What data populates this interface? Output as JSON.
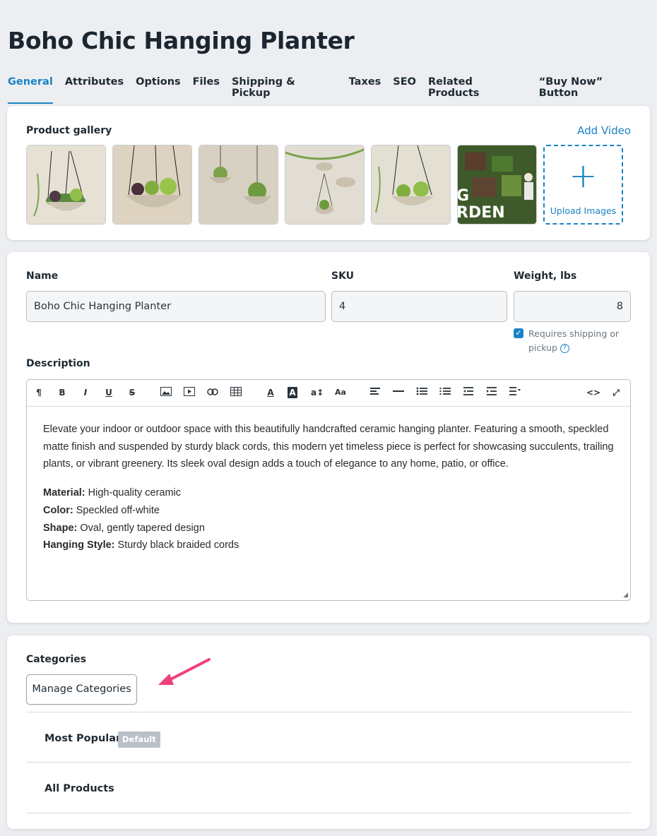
{
  "page": {
    "title": "Boho Chic Hanging Planter"
  },
  "tabs": [
    "General",
    "Attributes",
    "Options",
    "Files",
    "Shipping & Pickup",
    "Taxes",
    "SEO",
    "Related Products",
    "“Buy Now” Button"
  ],
  "gallery": {
    "label": "Product gallery",
    "add_video": "Add Video",
    "upload_label": "Upload Images",
    "thumbnails": [
      {
        "name": "planter-photo-1",
        "text": ""
      },
      {
        "name": "planter-photo-2",
        "text": ""
      },
      {
        "name": "planter-photo-3",
        "text": ""
      },
      {
        "name": "planter-photo-4",
        "text": ""
      },
      {
        "name": "planter-photo-5",
        "text": ""
      },
      {
        "name": "garden-video-thumbnail",
        "text": "G\nRDEN"
      }
    ]
  },
  "details": {
    "name_label": "Name",
    "name_value": "Boho Chic Hanging Planter",
    "sku_label": "SKU",
    "sku_value": "4",
    "weight_label": "Weight, lbs",
    "weight_value": "8",
    "requires_shipping": "Requires shipping or pickup",
    "requires_shipping_checked": true,
    "description_label": "Description",
    "description_paragraph": "Elevate your indoor or outdoor space with this beautifully handcrafted ceramic hanging planter. Featuring a smooth, speckled matte finish and suspended by sturdy black cords, this modern yet timeless piece is perfect for showcasing succulents, trailing plants, or vibrant greenery. Its sleek oval design adds a touch of elegance to any home, patio, or office.",
    "specs": [
      {
        "key": "Material:",
        "value": "High-quality ceramic"
      },
      {
        "key": "Color:",
        "value": "Speckled off-white"
      },
      {
        "key": "Shape:",
        "value": "Oval, gently tapered design"
      },
      {
        "key": "Hanging Style:",
        "value": "Sturdy black braided cords"
      }
    ]
  },
  "toolbar": {
    "icons": [
      "paragraph-icon",
      "bold-icon",
      "italic-icon",
      "underline-icon",
      "strikethrough-icon",
      "image-icon",
      "video-icon",
      "link-icon",
      "table-icon",
      "font-color-icon",
      "background-color-icon",
      "font-size-icon",
      "font-family-icon",
      "align-icon",
      "horizontal-rule-icon",
      "bullet-list-icon",
      "numbered-list-icon",
      "outdent-icon",
      "indent-icon",
      "more-paragraph-icon",
      "code-view-icon",
      "fullscreen-icon"
    ]
  },
  "categories": {
    "label": "Categories",
    "manage_button": "Manage Categories",
    "items": [
      {
        "name": "Most Popular",
        "badge": "Default"
      },
      {
        "name": "All Products",
        "badge": ""
      }
    ]
  },
  "colors": {
    "accent": "#1a83c4",
    "arrow": "#ee3f76",
    "badge": "#b9c0c7"
  }
}
